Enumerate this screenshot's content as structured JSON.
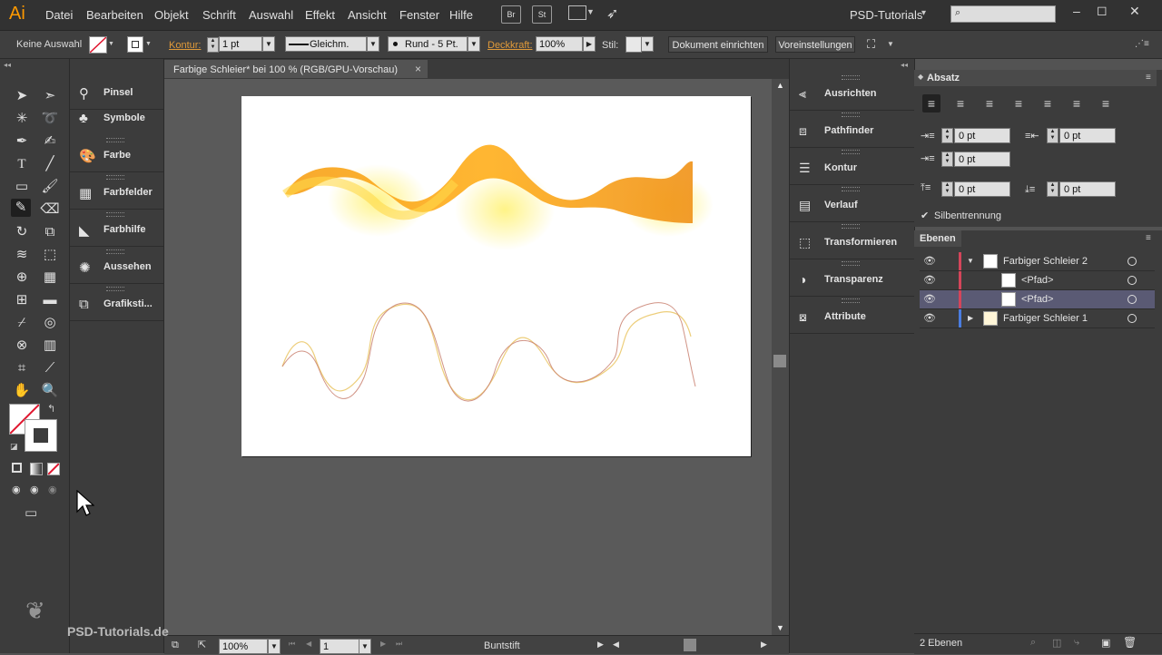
{
  "menubar": {
    "app_logo": "Ai",
    "items": [
      "Datei",
      "Bearbeiten",
      "Objekt",
      "Schrift",
      "Auswahl",
      "Effekt",
      "Ansicht",
      "Fenster",
      "Hilfe"
    ],
    "bridge_label": "Br",
    "stock_label": "St",
    "workspace": "PSD-Tutorials",
    "workspace_arrow": "▾",
    "search_placeholder": ""
  },
  "control": {
    "selection": "Keine Auswahl",
    "kontur_label": "Kontur:",
    "kontur_value": "1 pt",
    "stroke_profile": "Gleichm.",
    "brush": "Rund - 5 Pt.",
    "opacity_label": "Deckkraft:",
    "opacity_value": "100%",
    "style_label": "Stil:",
    "doc_setup_button": "Dokument einrichten",
    "prefs_button": "Voreinstellungen"
  },
  "left_panels": [
    {
      "label": "Pinsel",
      "icon": "brush-icon"
    },
    {
      "label": "Symbole",
      "icon": "symbols-icon"
    },
    {
      "label": "Farbe",
      "icon": "color-palette-icon"
    },
    {
      "label": "Farbfelder",
      "icon": "swatches-icon"
    },
    {
      "label": "Farbhilfe",
      "icon": "color-guide-icon"
    },
    {
      "label": "Aussehen",
      "icon": "appearance-icon"
    },
    {
      "label": "Grafiksti...",
      "icon": "graphic-styles-icon"
    }
  ],
  "document": {
    "tab_title": "Farbige Schleier* bei 100 % (RGB/GPU-Vorschau)",
    "close": "×"
  },
  "statusbar": {
    "zoom": "100%",
    "artboard_number": "1",
    "tool_name": "Buntstift"
  },
  "right_panels": [
    {
      "label": "Ausrichten",
      "icon": "align-icon"
    },
    {
      "label": "Pathfinder",
      "icon": "pathfinder-icon"
    },
    {
      "label": "Kontur",
      "icon": "stroke-icon"
    },
    {
      "label": "Verlauf",
      "icon": "gradient-icon"
    },
    {
      "label": "Transformieren",
      "icon": "transform-icon"
    },
    {
      "label": "Transparenz",
      "icon": "transparency-icon"
    },
    {
      "label": "Attribute",
      "icon": "attributes-icon"
    }
  ],
  "paragraph": {
    "title": "Absatz",
    "left_indent": "0 pt",
    "right_indent": "0 pt",
    "first_line_indent": "0 pt",
    "space_before": "0 pt",
    "space_after": "0 pt",
    "hyphenation_label": "Silbentrennung",
    "hyphenation_checked": true
  },
  "layers": {
    "title": "Ebenen",
    "rows": [
      {
        "name": "Farbiger Schleier 2",
        "color": "#d4455a",
        "expanded": true
      },
      {
        "name": "<Pfad>",
        "color": "#d4455a"
      },
      {
        "name": "<Pfad>",
        "color": "#d4455a",
        "selected": true
      },
      {
        "name": "Farbiger Schleier 1",
        "color": "#4a7de0",
        "expanded": false
      }
    ],
    "count_label": "2 Ebenen"
  },
  "watermark": "PSD-Tutorials.de"
}
